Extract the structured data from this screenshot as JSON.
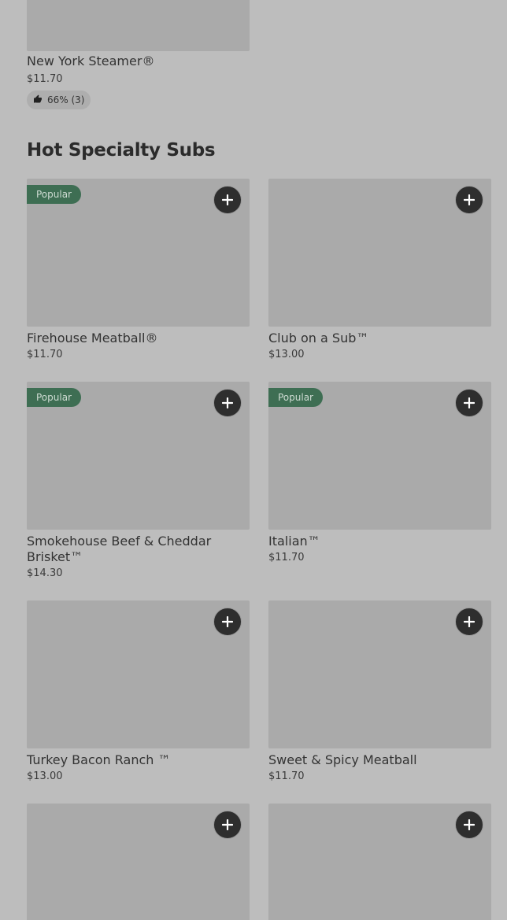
{
  "top_item": {
    "name": "New York Steamer®",
    "price": "$11.70",
    "rating": "66% (3)",
    "rating_icon": "thumbs-up-icon"
  },
  "section": {
    "title": "Hot Specialty Subs"
  },
  "items": [
    {
      "name": "Firehouse Meatball®",
      "price": "$11.70",
      "badge": "Popular"
    },
    {
      "name": "Club on a Sub™",
      "price": "$13.00",
      "badge": ""
    },
    {
      "name": "Smokehouse Beef & Cheddar Brisket™",
      "price": "$14.30",
      "badge": "Popular"
    },
    {
      "name": "Italian™",
      "price": "$11.70",
      "badge": "Popular"
    },
    {
      "name": "Turkey Bacon Ranch ™",
      "price": "$13.00",
      "badge": ""
    },
    {
      "name": "Sweet & Spicy Meatball",
      "price": "$11.70",
      "badge": ""
    }
  ],
  "add_icon": "plus-icon",
  "colors": {
    "background": "#bdbdbd",
    "image_placeholder": "#aaaaaa",
    "badge": "#3e6e53",
    "add_button": "#2e2e2e"
  }
}
